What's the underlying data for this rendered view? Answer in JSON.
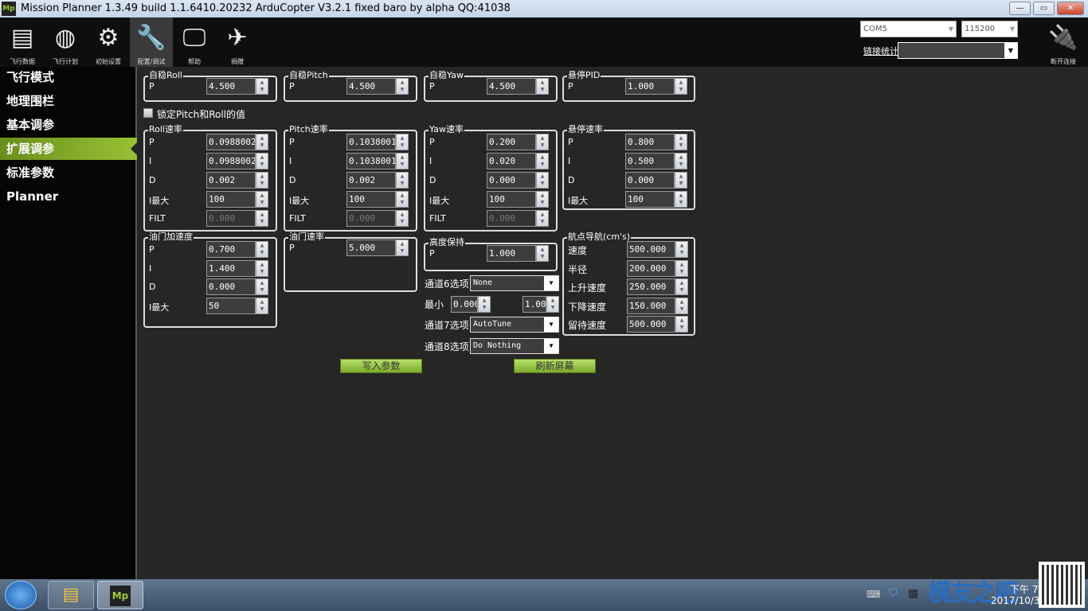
{
  "window": {
    "title": "Mission Planner 1.3.49 build 1.1.6410.20232 ArduCopter V3.2.1 fixed baro by alpha QQ:41038",
    "logo": "Mp"
  },
  "toolbar": {
    "items": [
      {
        "label": "飞行数据",
        "icon": "flight-data-icon"
      },
      {
        "label": "飞行计划",
        "icon": "flight-plan-icon"
      },
      {
        "label": "初始设置",
        "icon": "initial-setup-icon"
      },
      {
        "label": "配置/调试",
        "icon": "config-tuning-icon",
        "active": true
      },
      {
        "label": "帮助",
        "icon": "help-icon"
      },
      {
        "label": "捐赠",
        "icon": "donate-icon"
      }
    ],
    "port": "COM5",
    "baud": "115200",
    "link_stats": "链接统计",
    "connect": "断开连接"
  },
  "sidebar": {
    "items": [
      {
        "label": "飞行模式"
      },
      {
        "label": "地理围栏"
      },
      {
        "label": "基本调参"
      },
      {
        "label": "扩展调参",
        "active": true
      },
      {
        "label": "标准参数"
      },
      {
        "label": "Planner"
      }
    ]
  },
  "lock_checkbox": {
    "label": "锁定Pitch和Roll的值",
    "checked": false
  },
  "groups": [
    {
      "title": "自稳Roll",
      "rows": [
        {
          "label": "P",
          "value": "4.500"
        }
      ]
    },
    {
      "title": "自稳Pitch",
      "rows": [
        {
          "label": "P",
          "value": "4.500"
        }
      ]
    },
    {
      "title": "自稳Yaw",
      "rows": [
        {
          "label": "P",
          "value": "4.500"
        }
      ]
    },
    {
      "title": "悬停PID",
      "rows": [
        {
          "label": "P",
          "value": "1.000"
        }
      ]
    },
    {
      "title": "Roll速率",
      "rows": [
        {
          "label": "P",
          "value": "0.09880023"
        },
        {
          "label": "I",
          "value": "0.09880023"
        },
        {
          "label": "D",
          "value": "0.002"
        },
        {
          "label": "I最大",
          "value": "100"
        },
        {
          "label": "FILT",
          "value": "0.000",
          "disabled": true
        }
      ]
    },
    {
      "title": "Pitch速率",
      "rows": [
        {
          "label": "P",
          "value": "0.1038001"
        },
        {
          "label": "I",
          "value": "0.1038001"
        },
        {
          "label": "D",
          "value": "0.002"
        },
        {
          "label": "I最大",
          "value": "100"
        },
        {
          "label": "FILT",
          "value": "0.000",
          "disabled": true
        }
      ]
    },
    {
      "title": "Yaw速率",
      "rows": [
        {
          "label": "P",
          "value": "0.200"
        },
        {
          "label": "I",
          "value": "0.020"
        },
        {
          "label": "D",
          "value": "0.000"
        },
        {
          "label": "I最大",
          "value": "100"
        },
        {
          "label": "FILT",
          "value": "0.000",
          "disabled": true
        }
      ]
    },
    {
      "title": "悬停速率",
      "rows": [
        {
          "label": "P",
          "value": "0.800"
        },
        {
          "label": "I",
          "value": "0.500"
        },
        {
          "label": "D",
          "value": "0.000"
        },
        {
          "label": "I最大",
          "value": "100"
        }
      ]
    },
    {
      "title": "油门加速度",
      "rows": [
        {
          "label": "P",
          "value": "0.700"
        },
        {
          "label": "I",
          "value": "1.400"
        },
        {
          "label": "D",
          "value": "0.000"
        },
        {
          "label": "I最大",
          "value": "50"
        }
      ]
    },
    {
      "title": "油门速率",
      "rows": [
        {
          "label": "P",
          "value": "5.000"
        }
      ]
    },
    {
      "title": "高度保持",
      "rows": [
        {
          "label": "P",
          "value": "1.000"
        }
      ]
    },
    {
      "title": "航点导航(cm's)",
      "rows": [
        {
          "label": "速度",
          "value": "500.000"
        },
        {
          "label": "半径",
          "value": "200.000"
        },
        {
          "label": "上升速度",
          "value": "250.000"
        },
        {
          "label": "下降速度",
          "value": "150.000"
        },
        {
          "label": "留待速度",
          "value": "500.000"
        }
      ]
    }
  ],
  "channels": {
    "ch6_label": "通道6选项",
    "ch6_value": "None",
    "min_label": "最小",
    "min_value": "0.000",
    "max_value": "1.000",
    "ch7_label": "通道7选项",
    "ch7_value": "AutoTune",
    "ch8_label": "通道8选项",
    "ch8_value": "Do Nothing"
  },
  "buttons": {
    "write": "写入参数",
    "refresh": "刷新屏幕"
  },
  "taskbar": {
    "time": "下午 7:",
    "date": "2017/10/3",
    "watermark": "模友之吧"
  },
  "colors": {
    "accent": "#8cb832",
    "background": "#262626"
  }
}
